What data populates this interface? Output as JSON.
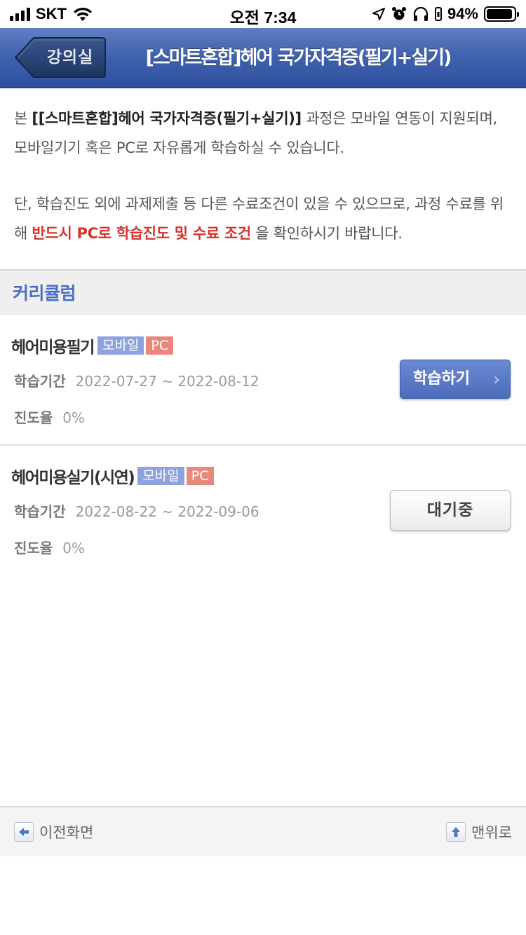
{
  "status_bar": {
    "carrier": "SKT",
    "time": "오전 7:34",
    "battery_percent": "94%",
    "battery_level": 0.94
  },
  "header": {
    "back_label": "강의실",
    "title": "[스마트혼합]헤어 국가자격증(필기+실기)"
  },
  "notice": {
    "p1_prefix": "본 ",
    "p1_course": "[[스마트혼합]헤어 국가자격증(필기+실기)]",
    "p1_suffix": " 과정은 모바일 연동이 지원되며, 모바일기기 혹은 PC로 자유롭게 학습하실 수 있습니다.",
    "p2_prefix": "단, 학습진도 외에 과제제출 등 다른 수료조건이 있을 수 있으므로, 과정 수료를 위해 ",
    "p2_highlight": "반드시 PC로 학습진도 및 수료 조건",
    "p2_suffix": " 을 확인하시기 바랍니다."
  },
  "curriculum": {
    "heading": "커리큘럼",
    "items": [
      {
        "title": "헤어미용필기",
        "badge_mobile": "모바일",
        "badge_pc": "PC",
        "period_label": "학습기간",
        "period": "2022-07-27 ~ 2022-08-12",
        "progress_label": "진도율",
        "progress": "0%",
        "action_label": "학습하기",
        "action_icon": "chevron-right-icon"
      },
      {
        "title": "헤어미용실기(시연)",
        "badge_mobile": "모바일",
        "badge_pc": "PC",
        "period_label": "학습기간",
        "period": "2022-08-22 ~ 2022-09-06",
        "progress_label": "진도율",
        "progress": "0%",
        "action_label": "대기중"
      }
    ]
  },
  "footer": {
    "prev_label": "이전화면",
    "top_label": "맨위로",
    "prev_icon": "arrow-left-icon",
    "top_icon": "arrow-up-icon"
  },
  "colors": {
    "header_blue": "#3f61ad",
    "accent_blue": "#4a6fc6",
    "highlight_red": "#d8322b",
    "badge_mobile": "#8ea2dd",
    "badge_pc": "#e9877a"
  }
}
